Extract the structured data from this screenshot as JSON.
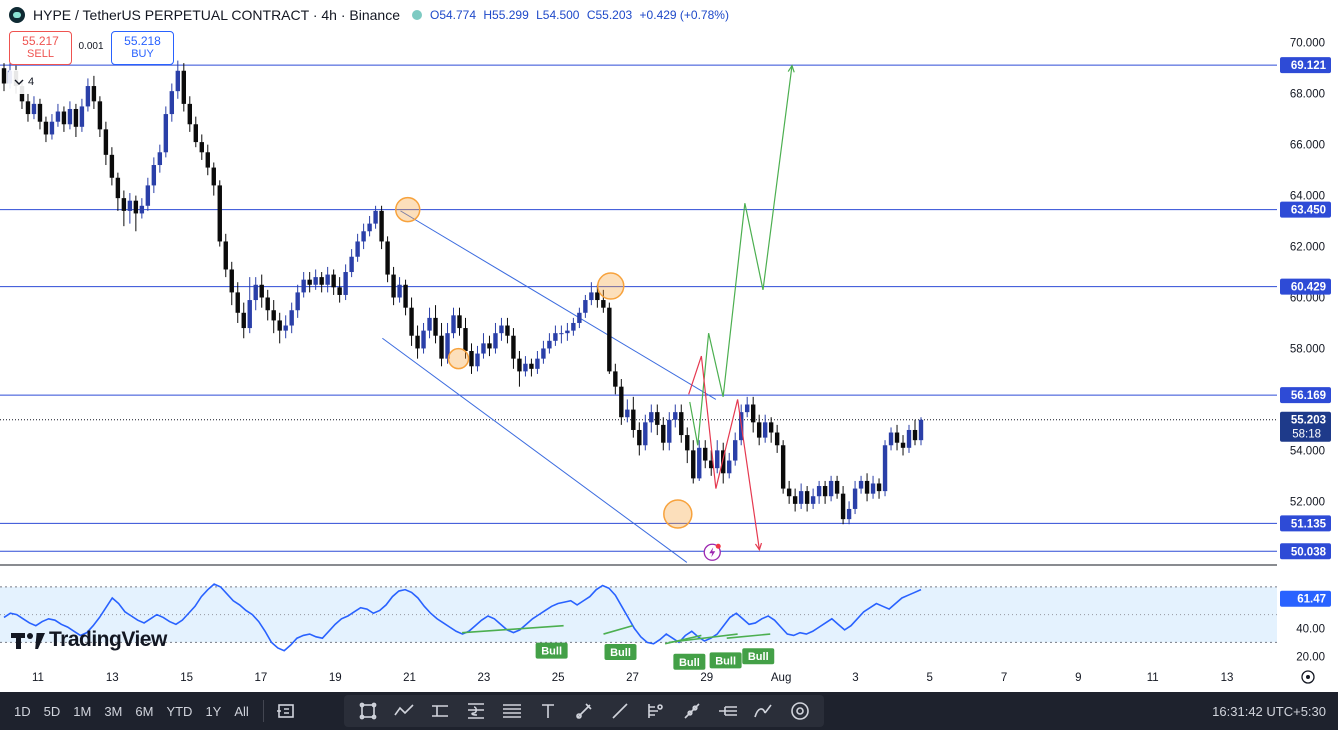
{
  "header": {
    "title": "HYPE / TetherUS PERPETUAL CONTRACT · 4h · Binance",
    "ohlc": {
      "open": "O54.774",
      "high": "H55.299",
      "low": "L54.500",
      "close": "C55.203",
      "change": "+0.429 (+0.78%)"
    }
  },
  "trade": {
    "sell_price": "55.217",
    "sell_label": "SELL",
    "spread": "0.001",
    "buy_price": "55.218",
    "buy_label": "BUY"
  },
  "indicators_collapse": {
    "count": "4",
    "icon": "chevron-down-icon"
  },
  "branding": {
    "logo_text": "TradingView"
  },
  "chart_data": {
    "type": "candlestick",
    "price_axis": {
      "ticks": [
        "70.000",
        "68.000",
        "66.000",
        "64.000",
        "62.000",
        "60.000",
        "58.000",
        "54.000",
        "52.000"
      ],
      "ylim": [
        49.5,
        70.5
      ]
    },
    "time_axis": {
      "ticks": [
        "11",
        "13",
        "15",
        "17",
        "19",
        "21",
        "23",
        "25",
        "27",
        "29",
        "Aug",
        "3",
        "5",
        "7",
        "9",
        "11",
        "13"
      ]
    },
    "levels": [
      {
        "price": 69.121,
        "label": "69.121"
      },
      {
        "price": 63.45,
        "label": "63.450"
      },
      {
        "price": 60.429,
        "label": "60.429"
      },
      {
        "price": 56.169,
        "label": "56.169"
      },
      {
        "price": 51.135,
        "label": "51.135"
      },
      {
        "price": 50.038,
        "label": "50.038"
      }
    ],
    "last_price": {
      "price": 55.203,
      "label": "55.203",
      "countdown": "58:18"
    },
    "series_colors": {
      "up": "#2a3fa8",
      "down": "#0b0b0b",
      "level": "#2e4bd6",
      "channel": "#3c6cdf",
      "bull_path": "#4caf50",
      "bear_path": "#e53950",
      "marker": "#f7a23c"
    },
    "candles": [
      [
        69.0,
        68.4,
        69.2,
        68.1
      ],
      [
        68.4,
        68.9,
        69.3,
        68.2
      ],
      [
        68.9,
        68.3,
        69.1,
        68.0
      ],
      [
        68.3,
        67.7,
        68.5,
        67.4
      ],
      [
        67.7,
        67.2,
        68.0,
        66.9
      ],
      [
        67.2,
        67.6,
        67.9,
        67.0
      ],
      [
        67.6,
        66.9,
        67.8,
        66.6
      ],
      [
        66.9,
        66.4,
        67.1,
        66.1
      ],
      [
        66.4,
        66.9,
        67.2,
        66.2
      ],
      [
        66.9,
        67.3,
        67.6,
        66.7
      ],
      [
        67.3,
        66.8,
        67.5,
        66.5
      ],
      [
        66.8,
        67.4,
        67.7,
        66.6
      ],
      [
        67.4,
        66.7,
        67.6,
        66.3
      ],
      [
        66.7,
        67.5,
        67.8,
        66.5
      ],
      [
        67.5,
        68.3,
        68.6,
        67.3
      ],
      [
        68.3,
        67.7,
        68.7,
        67.4
      ],
      [
        67.7,
        66.6,
        67.9,
        66.3
      ],
      [
        66.6,
        65.6,
        66.9,
        65.2
      ],
      [
        65.6,
        64.7,
        65.9,
        64.4
      ],
      [
        64.7,
        63.9,
        64.9,
        63.4
      ],
      [
        63.9,
        63.4,
        64.2,
        62.8
      ],
      [
        63.4,
        63.8,
        64.1,
        62.9
      ],
      [
        63.8,
        63.3,
        64.0,
        62.6
      ],
      [
        63.3,
        63.6,
        63.9,
        63.1
      ],
      [
        63.6,
        64.4,
        64.7,
        63.4
      ],
      [
        64.4,
        65.2,
        65.5,
        64.1
      ],
      [
        65.2,
        65.7,
        66.0,
        64.9
      ],
      [
        65.7,
        67.2,
        67.5,
        65.5
      ],
      [
        67.2,
        68.1,
        68.4,
        66.9
      ],
      [
        68.1,
        68.9,
        69.3,
        67.8
      ],
      [
        68.9,
        67.6,
        69.2,
        67.3
      ],
      [
        67.6,
        66.8,
        67.9,
        66.5
      ],
      [
        66.8,
        66.1,
        67.1,
        65.9
      ],
      [
        66.1,
        65.7,
        66.4,
        65.4
      ],
      [
        65.7,
        65.1,
        66.0,
        64.8
      ],
      [
        65.1,
        64.4,
        65.3,
        64.0
      ],
      [
        64.4,
        62.2,
        64.6,
        62.0
      ],
      [
        62.2,
        61.1,
        62.5,
        60.8
      ],
      [
        61.1,
        60.2,
        61.4,
        59.7
      ],
      [
        60.2,
        59.4,
        60.6,
        59.0
      ],
      [
        59.4,
        58.8,
        59.8,
        58.4
      ],
      [
        58.8,
        59.9,
        60.8,
        58.6
      ],
      [
        59.9,
        60.5,
        60.8,
        59.5
      ],
      [
        60.5,
        60.0,
        60.9,
        59.6
      ],
      [
        60.0,
        59.5,
        60.3,
        59.1
      ],
      [
        59.5,
        59.1,
        59.9,
        58.6
      ],
      [
        59.1,
        58.7,
        59.4,
        58.2
      ],
      [
        58.7,
        58.9,
        59.3,
        58.4
      ],
      [
        58.9,
        59.5,
        59.8,
        58.6
      ],
      [
        59.5,
        60.2,
        60.5,
        59.2
      ],
      [
        60.2,
        60.7,
        61.0,
        60.0
      ],
      [
        60.7,
        60.5,
        61.0,
        60.2
      ],
      [
        60.5,
        60.8,
        61.1,
        60.3
      ],
      [
        60.8,
        60.5,
        61.0,
        60.2
      ],
      [
        60.5,
        60.9,
        61.2,
        60.2
      ],
      [
        60.9,
        60.4,
        61.1,
        60.1
      ],
      [
        60.4,
        60.1,
        60.8,
        59.8
      ],
      [
        60.1,
        61.0,
        61.3,
        59.9
      ],
      [
        61.0,
        61.6,
        61.9,
        60.8
      ],
      [
        61.6,
        62.2,
        62.5,
        61.4
      ],
      [
        62.2,
        62.6,
        62.9,
        61.9
      ],
      [
        62.6,
        62.9,
        63.2,
        62.4
      ],
      [
        62.9,
        63.4,
        63.6,
        62.7
      ],
      [
        63.4,
        62.2,
        63.6,
        61.9
      ],
      [
        62.2,
        60.9,
        62.4,
        60.6
      ],
      [
        60.9,
        60.0,
        61.2,
        59.7
      ],
      [
        60.0,
        60.5,
        60.8,
        59.8
      ],
      [
        60.5,
        59.6,
        60.7,
        59.3
      ],
      [
        59.6,
        58.5,
        60.0,
        58.1
      ],
      [
        58.5,
        58.0,
        58.9,
        57.6
      ],
      [
        58.0,
        58.7,
        59.0,
        57.8
      ],
      [
        58.7,
        59.2,
        59.6,
        58.4
      ],
      [
        59.2,
        58.5,
        59.7,
        58.2
      ],
      [
        58.5,
        57.6,
        59.0,
        57.3
      ],
      [
        57.6,
        58.6,
        59.0,
        57.4
      ],
      [
        58.6,
        59.3,
        59.6,
        58.4
      ],
      [
        59.3,
        58.8,
        59.6,
        58.5
      ],
      [
        58.8,
        57.9,
        59.2,
        57.6
      ],
      [
        57.9,
        57.3,
        58.2,
        57.0
      ],
      [
        57.3,
        57.8,
        58.1,
        57.1
      ],
      [
        57.8,
        58.2,
        58.6,
        57.6
      ],
      [
        58.2,
        58.0,
        58.5,
        57.7
      ],
      [
        58.0,
        58.6,
        59.0,
        57.8
      ],
      [
        58.6,
        58.9,
        59.2,
        58.3
      ],
      [
        58.9,
        58.5,
        59.2,
        58.2
      ],
      [
        58.5,
        57.6,
        58.8,
        57.2
      ],
      [
        57.6,
        57.1,
        57.9,
        56.5
      ],
      [
        57.1,
        57.4,
        57.7,
        56.9
      ],
      [
        57.4,
        57.2,
        57.6,
        56.9
      ],
      [
        57.2,
        57.6,
        57.9,
        57.0
      ],
      [
        57.6,
        58.0,
        58.3,
        57.4
      ],
      [
        58.0,
        58.3,
        58.6,
        57.8
      ],
      [
        58.3,
        58.6,
        58.9,
        58.1
      ],
      [
        58.6,
        58.6,
        58.9,
        58.2
      ],
      [
        58.6,
        58.7,
        59.0,
        58.3
      ],
      [
        58.7,
        59.0,
        59.2,
        58.5
      ],
      [
        59.0,
        59.4,
        59.6,
        58.8
      ],
      [
        59.4,
        59.9,
        60.1,
        59.2
      ],
      [
        59.9,
        60.2,
        60.6,
        59.7
      ],
      [
        60.2,
        59.9,
        60.5,
        59.6
      ],
      [
        59.9,
        59.6,
        60.3,
        59.4
      ],
      [
        59.6,
        57.1,
        59.8,
        57.0
      ],
      [
        57.1,
        56.5,
        57.4,
        56.2
      ],
      [
        56.5,
        55.3,
        56.8,
        55.0
      ],
      [
        55.3,
        55.6,
        56.0,
        55.1
      ],
      [
        55.6,
        54.8,
        56.1,
        54.5
      ],
      [
        54.8,
        54.2,
        55.1,
        53.8
      ],
      [
        54.2,
        55.1,
        55.4,
        54.0
      ],
      [
        55.1,
        55.5,
        55.8,
        54.7
      ],
      [
        55.5,
        55.0,
        55.8,
        54.6
      ],
      [
        55.0,
        54.3,
        55.3,
        54.0
      ],
      [
        54.3,
        55.2,
        55.5,
        54.0
      ],
      [
        55.2,
        55.5,
        55.8,
        54.9
      ],
      [
        55.5,
        54.6,
        55.8,
        54.3
      ],
      [
        54.6,
        54.0,
        54.9,
        53.5
      ],
      [
        54.0,
        52.9,
        54.4,
        52.7
      ],
      [
        52.9,
        54.1,
        54.4,
        52.8
      ],
      [
        54.1,
        53.6,
        54.4,
        53.3
      ],
      [
        53.6,
        53.3,
        54.0,
        53.0
      ],
      [
        53.3,
        54.0,
        54.4,
        53.1
      ],
      [
        54.0,
        53.1,
        54.3,
        52.7
      ],
      [
        53.1,
        53.6,
        53.9,
        52.9
      ],
      [
        53.6,
        54.4,
        54.7,
        53.4
      ],
      [
        54.4,
        55.5,
        55.8,
        54.2
      ],
      [
        55.5,
        55.8,
        56.1,
        55.3
      ],
      [
        55.8,
        55.1,
        56.1,
        54.7
      ],
      [
        55.1,
        54.5,
        55.4,
        54.2
      ],
      [
        54.5,
        55.1,
        55.4,
        54.3
      ],
      [
        55.1,
        54.7,
        55.3,
        54.3
      ],
      [
        54.7,
        54.2,
        55.0,
        53.9
      ],
      [
        54.2,
        52.5,
        54.4,
        52.3
      ],
      [
        52.5,
        52.2,
        52.8,
        51.9
      ],
      [
        52.2,
        51.9,
        52.5,
        51.6
      ],
      [
        51.9,
        52.4,
        52.7,
        51.7
      ],
      [
        52.4,
        51.9,
        52.6,
        51.6
      ],
      [
        51.9,
        52.2,
        52.5,
        51.7
      ],
      [
        52.2,
        52.6,
        52.8,
        51.9
      ],
      [
        52.6,
        52.2,
        52.8,
        51.9
      ],
      [
        52.2,
        52.8,
        53.0,
        52.0
      ],
      [
        52.8,
        52.3,
        53.0,
        52.1
      ],
      [
        52.3,
        51.3,
        52.6,
        51.1
      ],
      [
        51.3,
        51.7,
        52.0,
        51.1
      ],
      [
        51.7,
        52.5,
        52.8,
        51.5
      ],
      [
        52.5,
        52.8,
        53.0,
        52.3
      ],
      [
        52.8,
        52.3,
        53.1,
        52.0
      ],
      [
        52.3,
        52.7,
        53.0,
        52.1
      ],
      [
        52.7,
        52.4,
        52.9,
        52.1
      ],
      [
        52.4,
        54.2,
        54.4,
        52.2
      ],
      [
        54.2,
        54.7,
        54.9,
        54.0
      ],
      [
        54.7,
        54.3,
        55.0,
        54.0
      ],
      [
        54.3,
        54.1,
        54.6,
        53.8
      ],
      [
        54.1,
        54.8,
        55.0,
        53.9
      ],
      [
        54.8,
        54.4,
        55.2,
        54.2
      ],
      [
        54.4,
        55.2,
        55.3,
        54.2
      ]
    ],
    "channel": {
      "upper": [
        [
          21.0,
          63.4
        ],
        [
          29.7,
          56.0
        ]
      ],
      "lower": [
        [
          20.5,
          58.4
        ],
        [
          28.9,
          49.6
        ]
      ]
    },
    "markers": [
      {
        "x": 21.2,
        "price": 63.45,
        "size": 12
      },
      {
        "x": 22.6,
        "price": 57.6,
        "size": 10
      },
      {
        "x": 26.8,
        "price": 60.45,
        "size": 13
      },
      {
        "x": 28.65,
        "price": 51.5,
        "size": 14
      }
    ],
    "bull_path": [
      [
        28.98,
        55.9
      ],
      [
        29.2,
        54.2
      ],
      [
        29.5,
        58.6
      ],
      [
        29.9,
        56.1
      ],
      [
        30.5,
        63.7
      ],
      [
        31.0,
        60.3
      ],
      [
        31.8,
        69.1
      ]
    ],
    "bear_path": [
      [
        28.95,
        56.2
      ],
      [
        29.3,
        57.7
      ],
      [
        29.7,
        52.5
      ],
      [
        30.3,
        56.0
      ],
      [
        30.9,
        50.1
      ]
    ],
    "rsi": {
      "value_label": "61.47",
      "ticks": [
        "40.00",
        "20.00"
      ],
      "band": [
        30,
        70
      ],
      "values": [
        48,
        51,
        50,
        47,
        44,
        42,
        45,
        47,
        46,
        43,
        41,
        38,
        35,
        37,
        42,
        48,
        55,
        62,
        58,
        52,
        49,
        46,
        44,
        47,
        50,
        48,
        45,
        43,
        46,
        51,
        56,
        63,
        68,
        72,
        70,
        65,
        60,
        57,
        53,
        50,
        45,
        38,
        30,
        26,
        24,
        28,
        33,
        35,
        36,
        34,
        33,
        38,
        43,
        47,
        49,
        52,
        55,
        54,
        51,
        53,
        57,
        63,
        67,
        68,
        66,
        62,
        56,
        51,
        47,
        44,
        41,
        38,
        36,
        38,
        42,
        46,
        49,
        47,
        43,
        39,
        37,
        39,
        43,
        47,
        50,
        53,
        56,
        58,
        59,
        60,
        57,
        60,
        63,
        68,
        71,
        69,
        64,
        56,
        48,
        40,
        34,
        30,
        29,
        32,
        36,
        33,
        30,
        35,
        38,
        34,
        31,
        33,
        36,
        42,
        48,
        51,
        47,
        43,
        44,
        47,
        49,
        46,
        41,
        36,
        35,
        37,
        36,
        38,
        41,
        44,
        47,
        43,
        39,
        42,
        47,
        52,
        55,
        58,
        56,
        54,
        58,
        62,
        64,
        66,
        68
      ]
    },
    "divergences": [
      {
        "from": [
          0.7,
          42
        ],
        "to": [
          1.9,
          45
        ],
        "label": "Bull"
      },
      {
        "from": [
          22.7,
          37
        ],
        "to": [
          25.5,
          42
        ],
        "label": "Bull"
      },
      {
        "from": [
          26.6,
          36
        ],
        "to": [
          27.4,
          42
        ],
        "label": "Bull"
      },
      {
        "from": [
          28.3,
          29
        ],
        "to": [
          29.3,
          35
        ],
        "label": "Bull"
      },
      {
        "from": [
          28.4,
          30
        ],
        "to": [
          30.3,
          36
        ],
        "label": "Bull"
      },
      {
        "from": [
          30.0,
          33
        ],
        "to": [
          31.2,
          36
        ],
        "label": "Bull"
      }
    ]
  },
  "timeframes": [
    "1D",
    "5D",
    "1M",
    "3M",
    "6M",
    "YTD",
    "1Y",
    "All"
  ],
  "tools": [
    "replay-icon",
    "rectangle-icon",
    "path-icon",
    "long-position-icon",
    "short-position-icon",
    "fib-icon",
    "text-icon",
    "brush-icon",
    "trend-line-icon",
    "regression-icon",
    "parallel-channel-icon",
    "pitchfork-icon",
    "curve-icon",
    "target-icon"
  ],
  "clock": "16:31:42 UTC+5:30"
}
